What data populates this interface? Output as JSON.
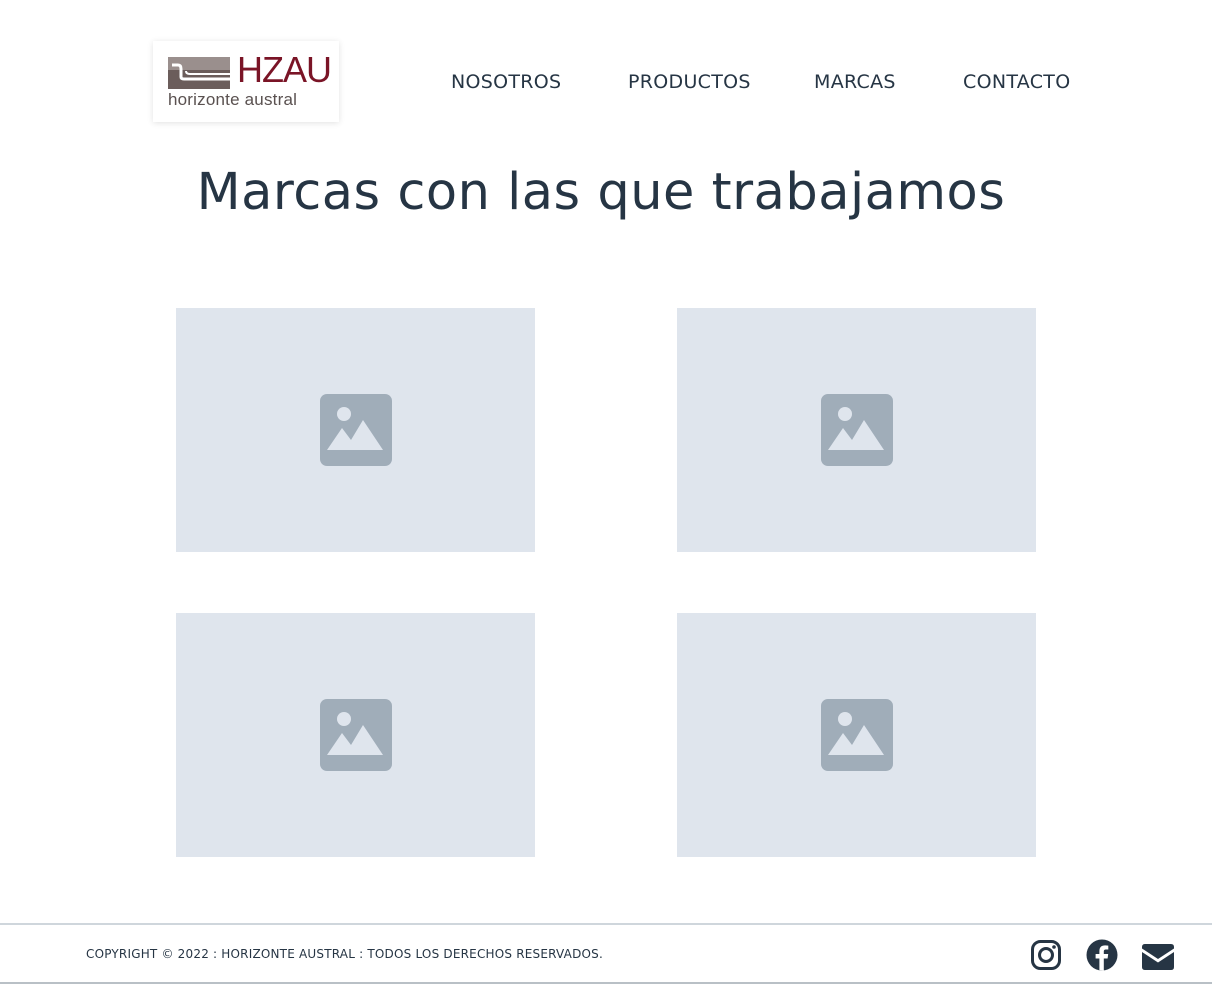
{
  "logo": {
    "wordmark": "HZAU",
    "tagline": "horizonte austral"
  },
  "nav": {
    "items": [
      {
        "label": "NOSOTROS"
      },
      {
        "label": "PRODUCTOS"
      },
      {
        "label": "MARCAS"
      },
      {
        "label": "CONTACTO"
      }
    ]
  },
  "main": {
    "title": "Marcas con las que trabajamos",
    "brands": [
      {
        "icon": "image-placeholder-icon"
      },
      {
        "icon": "image-placeholder-icon"
      },
      {
        "icon": "image-placeholder-icon"
      },
      {
        "icon": "image-placeholder-icon"
      }
    ]
  },
  "footer": {
    "copyright": "COPYRIGHT © 2022 : HORIZONTE AUSTRAL : TODOS LOS DERECHOS RESERVADOS.",
    "social": [
      {
        "icon": "instagram-icon"
      },
      {
        "icon": "facebook-icon"
      },
      {
        "icon": "email-icon"
      }
    ]
  },
  "colors": {
    "text": "#263544",
    "brand_red": "#7a1426",
    "placeholder_bg": "#dfe5ed",
    "placeholder_icon": "#a0adb9"
  }
}
